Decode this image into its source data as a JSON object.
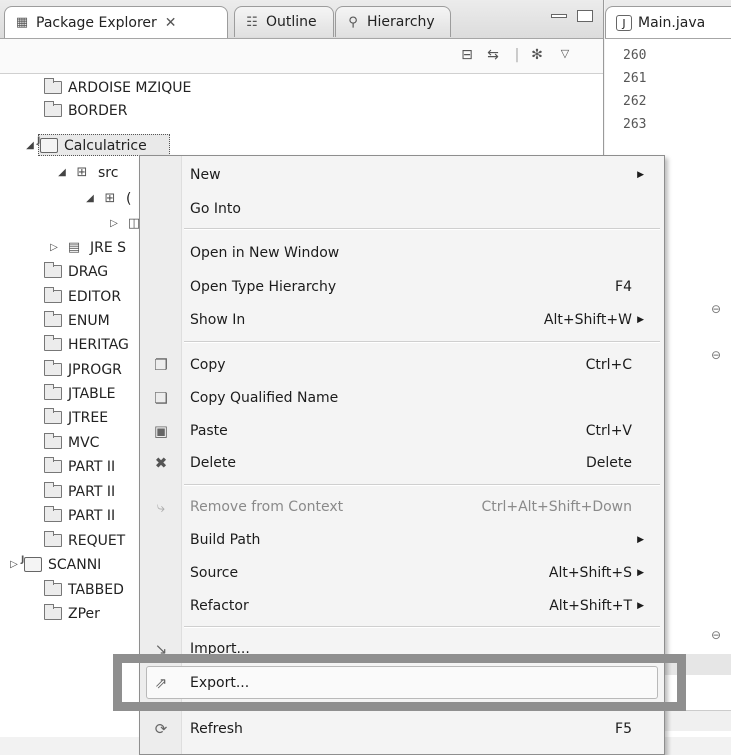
{
  "explorer": {
    "tabs": [
      {
        "label": "Package Explorer",
        "icon": "package-icon",
        "close": "✕"
      },
      {
        "label": "Outline",
        "icon": "outline-icon"
      },
      {
        "label": "Hierarchy",
        "icon": "hierarchy-icon"
      }
    ],
    "tree": [
      {
        "label": "ARDOISE MZIQUE",
        "type": "folder"
      },
      {
        "label": "BORDER",
        "type": "folder"
      },
      {
        "label": "Calculatrice",
        "type": "project",
        "expanded": true,
        "selected": true
      },
      {
        "label": "src",
        "type": "src",
        "expanded": true
      },
      {
        "label": "(",
        "type": "package",
        "expanded": true
      },
      {
        "label": "",
        "type": "file"
      },
      {
        "label": "JRE S",
        "type": "library",
        "collapsed": true
      },
      {
        "label": "DRAG",
        "type": "folder"
      },
      {
        "label": "EDITOR",
        "type": "folder"
      },
      {
        "label": "ENUM",
        "type": "folder"
      },
      {
        "label": "HERITAG",
        "type": "folder"
      },
      {
        "label": "JPROGR",
        "type": "folder"
      },
      {
        "label": "JTABLE",
        "type": "folder"
      },
      {
        "label": "JTREE",
        "type": "folder"
      },
      {
        "label": "MVC",
        "type": "folder"
      },
      {
        "label": "PART II",
        "type": "folder"
      },
      {
        "label": "PART II",
        "type": "folder"
      },
      {
        "label": "PART II",
        "type": "folder"
      },
      {
        "label": "REQUET",
        "type": "folder"
      },
      {
        "label": "SCANNI",
        "type": "project",
        "collapsed": true
      },
      {
        "label": "TABBED",
        "type": "folder"
      },
      {
        "label": "ZPer",
        "type": "folder"
      }
    ]
  },
  "editor": {
    "tab_label": "Main.java",
    "line_numbers": [
      "260",
      "261",
      "262",
      "263"
    ]
  },
  "context_menu": {
    "items": [
      {
        "label": "New",
        "shortcut": "",
        "submenu": true,
        "icon": ""
      },
      {
        "label": "Go Into",
        "shortcut": ""
      },
      {
        "label": "Open in New Window",
        "shortcut": ""
      },
      {
        "label": "Open Type Hierarchy",
        "shortcut": "F4"
      },
      {
        "label": "Show In",
        "shortcut": "Alt+Shift+W",
        "submenu": true
      },
      {
        "label": "Copy",
        "shortcut": "Ctrl+C",
        "icon": "copy-icon"
      },
      {
        "label": "Copy Qualified Name",
        "shortcut": "",
        "icon": "copy-qualified-icon"
      },
      {
        "label": "Paste",
        "shortcut": "Ctrl+V",
        "icon": "paste-icon"
      },
      {
        "label": "Delete",
        "shortcut": "Delete",
        "icon": "delete-icon"
      },
      {
        "label": "Remove from Context",
        "shortcut": "Ctrl+Alt+Shift+Down",
        "disabled": true,
        "icon": "remove-context-icon"
      },
      {
        "label": "Build Path",
        "shortcut": "",
        "submenu": true
      },
      {
        "label": "Source",
        "shortcut": "Alt+Shift+S",
        "submenu": true
      },
      {
        "label": "Refactor",
        "shortcut": "Alt+Shift+T",
        "submenu": true
      },
      {
        "label": "Import...",
        "shortcut": "",
        "icon": "import-icon"
      },
      {
        "label": "Export...",
        "shortcut": "",
        "icon": "export-icon",
        "highlighted": true
      },
      {
        "label": "Refresh",
        "shortcut": "F5",
        "icon": "refresh-icon"
      }
    ]
  },
  "colors": {
    "callout_border": "#8f8f8f",
    "menu_background": "#f4f4f4"
  }
}
